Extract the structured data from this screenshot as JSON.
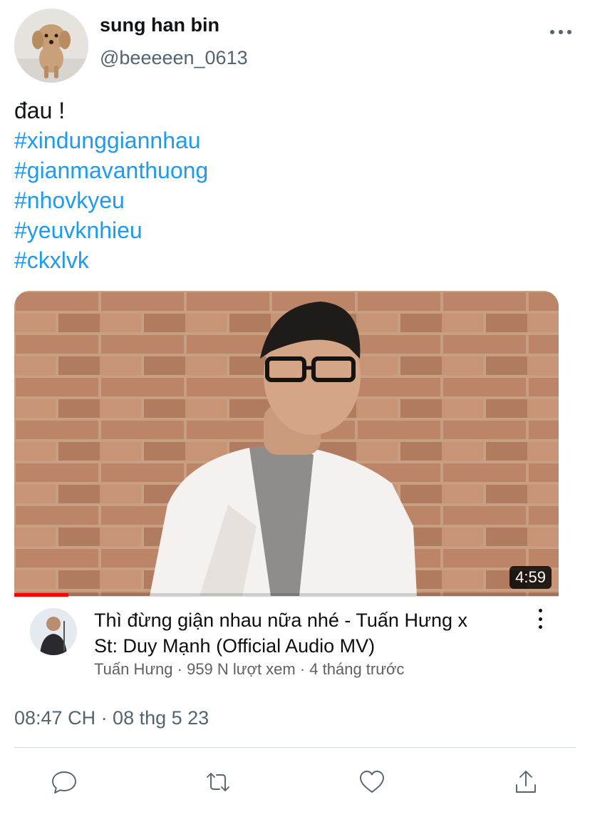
{
  "user": {
    "display_name": "sung han bin",
    "handle": "@beeeeen_0613"
  },
  "tweet": {
    "lines": [
      {
        "text": "đau !",
        "type": "text"
      },
      {
        "text": "#xindunggiannhau",
        "type": "hashtag"
      },
      {
        "text": "#gianmavanthuong",
        "type": "hashtag"
      },
      {
        "text": "#nhovkyeu",
        "type": "hashtag"
      },
      {
        "text": "#yeuvknhieu",
        "type": "hashtag"
      },
      {
        "text": "#ckxlvk",
        "type": "hashtag"
      }
    ],
    "timestamp": "08:47 CH · 08 thg 5 23"
  },
  "video_card": {
    "duration": "4:59",
    "progress_fraction": 0.1,
    "title_line1": "Thì đừng giận nhau nữa nhé  - Tuấn Hưng x",
    "title_line2": "St: Duy Mạnh (Official Audio MV)",
    "meta": "Tuấn Hưng · 959 N lượt xem · 4 tháng trước"
  },
  "actions": [
    {
      "name": "reply-button",
      "icon": "reply-icon"
    },
    {
      "name": "retweet-button",
      "icon": "retweet-icon"
    },
    {
      "name": "like-button",
      "icon": "heart-icon"
    },
    {
      "name": "share-button",
      "icon": "share-icon"
    }
  ],
  "colors": {
    "hashtag": "#1d9bf0",
    "secondary_text": "#536471",
    "progress": "#ff0000"
  }
}
